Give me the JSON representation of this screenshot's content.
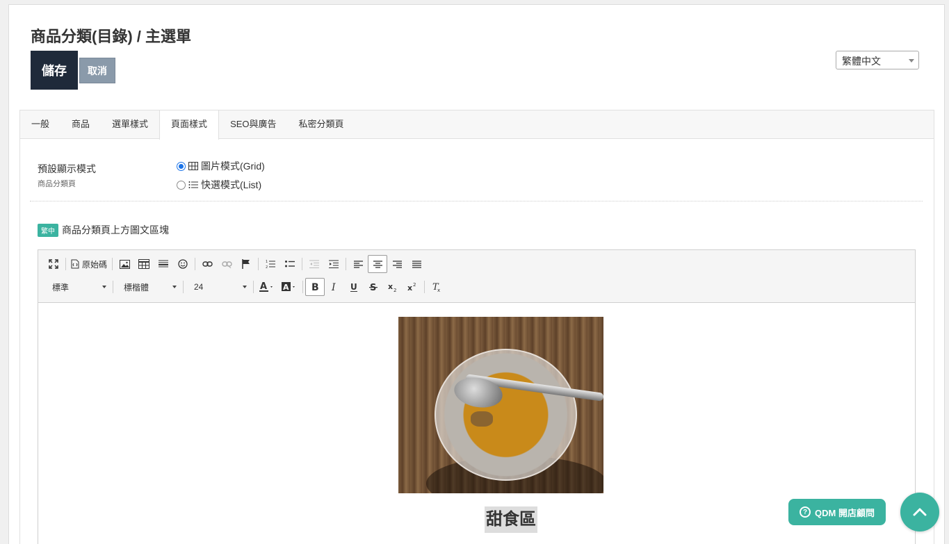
{
  "header": {
    "title": "商品分類(目錄) / 主選單",
    "save_label": "儲存",
    "cancel_label": "取消",
    "language": "繁體中文"
  },
  "tabs": [
    {
      "label": "一般"
    },
    {
      "label": "商品"
    },
    {
      "label": "選單樣式"
    },
    {
      "label": "頁面樣式",
      "active": true
    },
    {
      "label": "SEO與廣告"
    },
    {
      "label": "私密分類頁"
    }
  ],
  "display_mode": {
    "label": "預設顯示模式",
    "sublabel": "商品分類頁",
    "options": [
      {
        "label": "圖片模式(Grid)",
        "icon": "grid-icon",
        "checked": true
      },
      {
        "label": "快選模式(List)",
        "icon": "list-icon",
        "checked": false
      }
    ]
  },
  "block": {
    "badge": "繁中",
    "title": "商品分類頁上方圖文區塊"
  },
  "editor": {
    "source_label": "原始碼",
    "format": "標準",
    "font": "標楷體",
    "size": "24",
    "caption": "甜食區"
  },
  "floating": {
    "consult_label": "QDM 開店顧問",
    "consult_icon": "help-circle-icon",
    "top_icon": "chevron-up-icon"
  },
  "colors": {
    "accent": "#3bb3a0",
    "save_bg": "#1f2a3a",
    "radio": "#1a73e8"
  }
}
